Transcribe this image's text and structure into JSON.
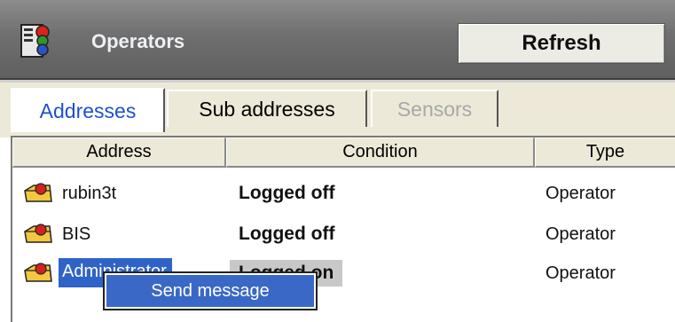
{
  "header": {
    "title": "Operators",
    "refresh_label": "Refresh",
    "icon": "traffic-light-server-icon"
  },
  "tabs": [
    {
      "label": "Addresses",
      "state": "active"
    },
    {
      "label": "Sub addresses",
      "state": "normal"
    },
    {
      "label": "Sensors",
      "state": "disabled"
    }
  ],
  "table": {
    "columns": [
      "Address",
      "Condition",
      "Type"
    ],
    "rows": [
      {
        "address": "rubin3t",
        "condition": "Logged off",
        "type": "Operator",
        "icon": "operator-folder-icon"
      },
      {
        "address": "BIS",
        "condition": "Logged off",
        "type": "Operator",
        "icon": "operator-folder-icon"
      },
      {
        "address": "Administrator",
        "condition": "Logged on",
        "type": "Operator",
        "icon": "operator-folder-icon",
        "selected": true
      }
    ]
  },
  "context_menu": {
    "items": [
      "Send message"
    ]
  },
  "colors": {
    "header_bg": "#6f6f6f",
    "active_tab_text": "#1f4fd0",
    "selection": "#2f63c8",
    "menu_bg": "#3a68c6"
  }
}
